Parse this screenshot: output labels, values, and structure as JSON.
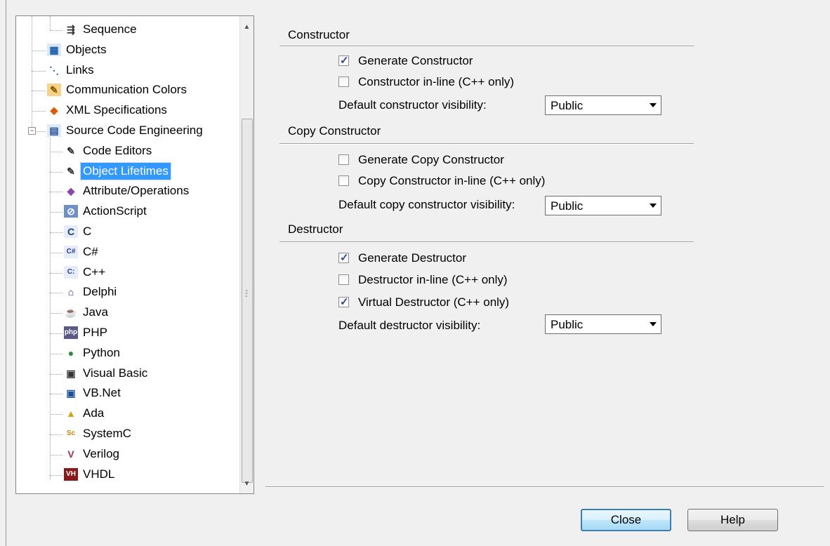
{
  "tree": {
    "items": [
      {
        "label": "Sequence",
        "icon": "sequence-icon",
        "indent": 2
      },
      {
        "label": "Objects",
        "icon": "objects-icon",
        "indent": 1
      },
      {
        "label": "Links",
        "icon": "links-icon",
        "indent": 1
      },
      {
        "label": "Communication Colors",
        "icon": "palette-icon",
        "indent": 1
      },
      {
        "label": "XML Specifications",
        "icon": "xml-icon",
        "indent": 1
      },
      {
        "label": "Source Code Engineering",
        "icon": "source-code-icon",
        "indent": 1
      },
      {
        "label": "Code Editors",
        "icon": "code-editor-icon",
        "indent": 2
      },
      {
        "label": "Object Lifetimes",
        "icon": "object-lifetimes-icon",
        "indent": 2
      },
      {
        "label": "Attribute/Operations",
        "icon": "attribute-operations-icon",
        "indent": 2
      },
      {
        "label": "ActionScript",
        "icon": "actionscript-icon",
        "indent": 2
      },
      {
        "label": "C",
        "icon": "c-icon",
        "indent": 2
      },
      {
        "label": "C#",
        "icon": "csharp-icon",
        "indent": 2
      },
      {
        "label": "C++",
        "icon": "cpp-icon",
        "indent": 2
      },
      {
        "label": "Delphi",
        "icon": "delphi-icon",
        "indent": 2
      },
      {
        "label": "Java",
        "icon": "java-icon",
        "indent": 2
      },
      {
        "label": "PHP",
        "icon": "php-icon",
        "indent": 2
      },
      {
        "label": "Python",
        "icon": "python-icon",
        "indent": 2
      },
      {
        "label": "Visual Basic",
        "icon": "visual-basic-icon",
        "indent": 2
      },
      {
        "label": "VB.Net",
        "icon": "vbnet-icon",
        "indent": 2
      },
      {
        "label": "Ada",
        "icon": "ada-icon",
        "indent": 2
      },
      {
        "label": "SystemC",
        "icon": "systemc-icon",
        "indent": 2
      },
      {
        "label": "Verilog",
        "icon": "verilog-icon",
        "indent": 2
      },
      {
        "label": "VHDL",
        "icon": "vhdl-icon",
        "indent": 2
      }
    ],
    "selected_label": "Object Lifetimes",
    "expander_symbol": "−"
  },
  "constructor": {
    "title": "Constructor",
    "generate_label": "Generate Constructor",
    "generate_checked": true,
    "inline_label": "Constructor in-line (C++ only)",
    "inline_checked": false,
    "visibility_label": "Default constructor visibility:",
    "visibility_value": "Public"
  },
  "copy_constructor": {
    "title": "Copy Constructor",
    "generate_label": "Generate Copy Constructor",
    "generate_checked": false,
    "inline_label": "Copy Constructor in-line (C++ only)",
    "inline_checked": false,
    "visibility_label": "Default copy constructor visibility:",
    "visibility_value": "Public"
  },
  "destructor": {
    "title": "Destructor",
    "generate_label": "Generate Destructor",
    "generate_checked": true,
    "inline_label": "Destructor in-line (C++ only)",
    "inline_checked": false,
    "virtual_label": "Virtual Destructor (C++ only)",
    "virtual_checked": true,
    "visibility_label": "Default destructor visibility:",
    "visibility_value": "Public"
  },
  "buttons": {
    "close_label": "Close",
    "help_label": "Help"
  },
  "colors": {
    "selection": "#3399ff",
    "checkmark": "#2a4b9a"
  }
}
